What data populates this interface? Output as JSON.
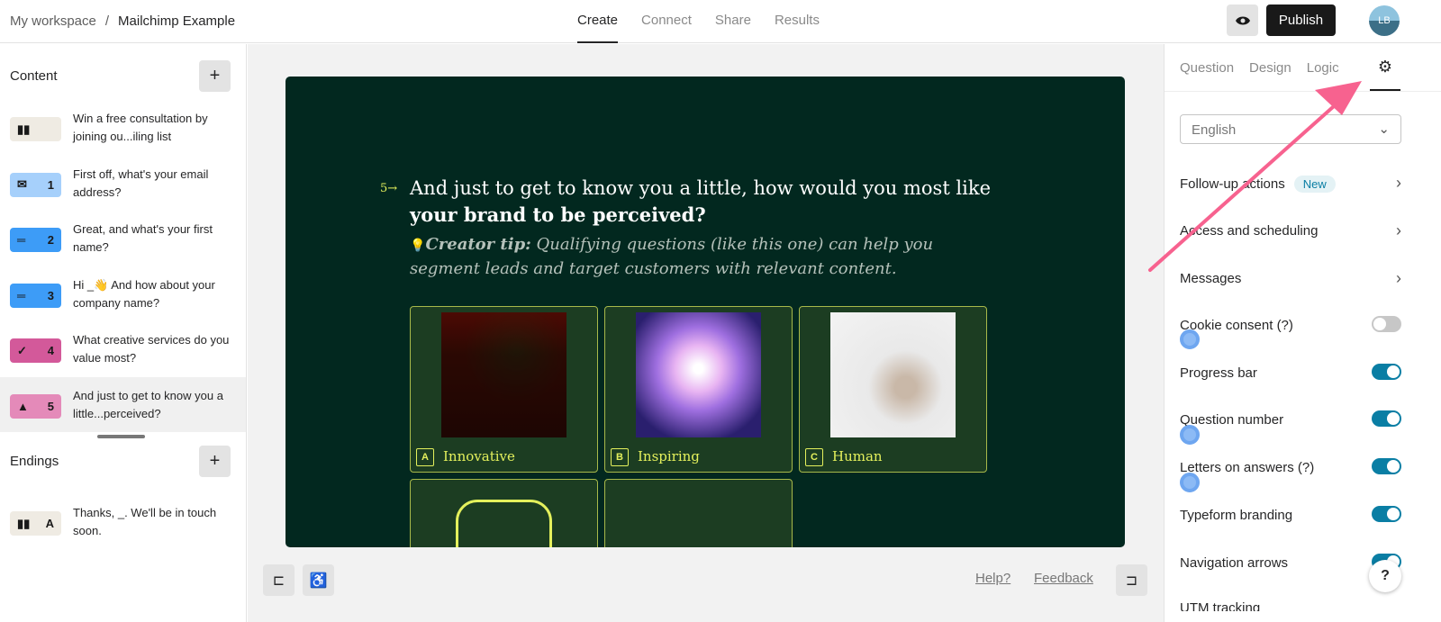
{
  "header": {
    "workspace": "My workspace",
    "separator": "/",
    "form_name": "Mailchimp Example",
    "tabs": [
      "Create",
      "Connect",
      "Share",
      "Results"
    ],
    "active_tab": "Create",
    "publish_label": "Publish",
    "avatar_initials": "LB"
  },
  "sidebar": {
    "content_title": "Content",
    "endings_title": "Endings",
    "items": [
      {
        "type": "welcome",
        "num": "",
        "text": "Win a free consultation by joining ou...iling list",
        "color": "#efebe3"
      },
      {
        "type": "email",
        "num": "1",
        "text": "First off, what's your email address?",
        "color": "#a6d0fb"
      },
      {
        "type": "short-text",
        "num": "2",
        "text": "Great, and what's your first name?",
        "color": "#3d9cf7"
      },
      {
        "type": "short-text",
        "num": "3",
        "text": "Hi _👋 And how about your company name?",
        "color": "#3d9cf7"
      },
      {
        "type": "multiple-choice",
        "num": "4",
        "text": "What creative services do you value most?",
        "color": "#d3599a"
      },
      {
        "type": "picture-choice",
        "num": "5",
        "text": "And just to get to know you a little...perceived?",
        "color": "#e48ab9"
      }
    ],
    "endings": [
      {
        "num": "A",
        "text": "Thanks, _. We'll be in touch soon.",
        "color": "#efebe3"
      }
    ]
  },
  "question": {
    "number": "5",
    "arrow": "→",
    "title_regular": "And just to get to know you a little, how would you most like ",
    "title_bold": "your brand to be perceived?",
    "tip_label": "Creator tip:",
    "tip_text": " Qualifying questions (like this one) can help you segment leads and target customers with relevant content.",
    "choices": [
      {
        "letter": "A",
        "label": "Innovative"
      },
      {
        "letter": "B",
        "label": "Inspiring"
      },
      {
        "letter": "C",
        "label": "Human"
      }
    ]
  },
  "footer": {
    "help": "Help?",
    "feedback": "Feedback"
  },
  "settings": {
    "tabs": [
      "Question",
      "Design",
      "Logic"
    ],
    "language": "English",
    "links": [
      {
        "label": "Follow-up actions",
        "badge": "New"
      },
      {
        "label": "Access and scheduling"
      },
      {
        "label": "Messages"
      }
    ],
    "toggles": [
      {
        "label": "Cookie consent (?)",
        "on": false
      },
      {
        "label": "Progress bar",
        "on": true
      },
      {
        "label": "Question number",
        "on": true
      },
      {
        "label": "Letters on answers (?)",
        "on": true
      },
      {
        "label": "Typeform branding",
        "on": true
      },
      {
        "label": "Navigation arrows",
        "on": true
      }
    ],
    "partial": "UTM tracking"
  },
  "help_button": "?",
  "colors": {
    "canvas": "#02281f",
    "accent": "#e4f05c",
    "toggle": "#0a7ea4",
    "annotation_arrow": "#f7628f"
  }
}
